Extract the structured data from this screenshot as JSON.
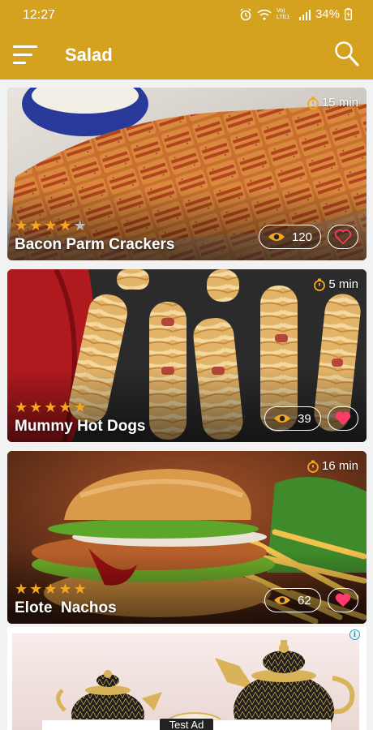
{
  "status_bar": {
    "time": "12:27",
    "battery": "34%",
    "network": "Vo) LTE1"
  },
  "app_bar": {
    "title": "Salad"
  },
  "cards": [
    {
      "title": "Bacon Parm Crackers",
      "time": "15 min",
      "views": "120",
      "rating": 4,
      "favorite": false
    },
    {
      "title": "Mummy Hot Dogs",
      "time": "5 min",
      "views": "39",
      "rating": 5,
      "favorite": true
    },
    {
      "title": "Elote  Nachos",
      "time": "16 min",
      "views": "62",
      "rating": 5,
      "favorite": true
    }
  ],
  "ad": {
    "info": "i",
    "label": "Test Ad"
  },
  "colors": {
    "appbar": "#d4a21f",
    "star": "#f5a623",
    "heart_active": "#ff3b6b",
    "info": "#16a0c6"
  }
}
